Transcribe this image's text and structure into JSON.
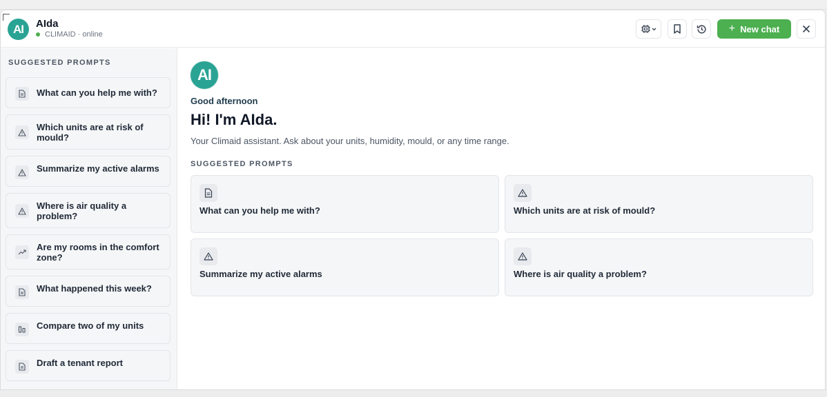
{
  "header": {
    "app_name": "AIda",
    "subtitle": "CLIMAID · online",
    "avatar_text": "AI",
    "new_chat_label": "New chat",
    "icons": [
      "chip-icon",
      "bookmark-icon",
      "history-icon",
      "plus-icon",
      "close-icon"
    ]
  },
  "sidebar": {
    "title": "SUGGESTED PROMPTS",
    "items": [
      {
        "label": "What can you help me with?",
        "icon": "document-icon"
      },
      {
        "label": "Which units are at risk of mould?",
        "icon": "warning-icon"
      },
      {
        "label": "Summarize my active alarms",
        "icon": "warning-icon"
      },
      {
        "label": "Where is air quality a problem?",
        "icon": "warning-icon"
      },
      {
        "label": "Are my rooms in the comfort zone?",
        "icon": "trend-up-icon"
      },
      {
        "label": "What happened this week?",
        "icon": "document-icon"
      },
      {
        "label": "Compare two of my units",
        "icon": "compare-bars-icon"
      },
      {
        "label": "Draft a tenant report",
        "icon": "document-icon"
      }
    ]
  },
  "main": {
    "avatar_text": "AI",
    "greeting": "Good afternoon",
    "headline": "Hi! I'm AIda.",
    "description": "Your Climaid assistant. Ask about your units, humidity, mould, or any time range.",
    "prompts_title": "SUGGESTED PROMPTS",
    "cards": [
      {
        "label": "What can you help me with?",
        "icon": "document-icon"
      },
      {
        "label": "Which units are at risk of mould?",
        "icon": "warning-icon"
      },
      {
        "label": "Summarize my active alarms",
        "icon": "warning-icon"
      },
      {
        "label": "Where is air quality a problem?",
        "icon": "warning-icon"
      }
    ]
  },
  "colors": {
    "accent_green": "#4caf50",
    "avatar_teal": "#2aa394",
    "status_online": "#4caf50"
  }
}
